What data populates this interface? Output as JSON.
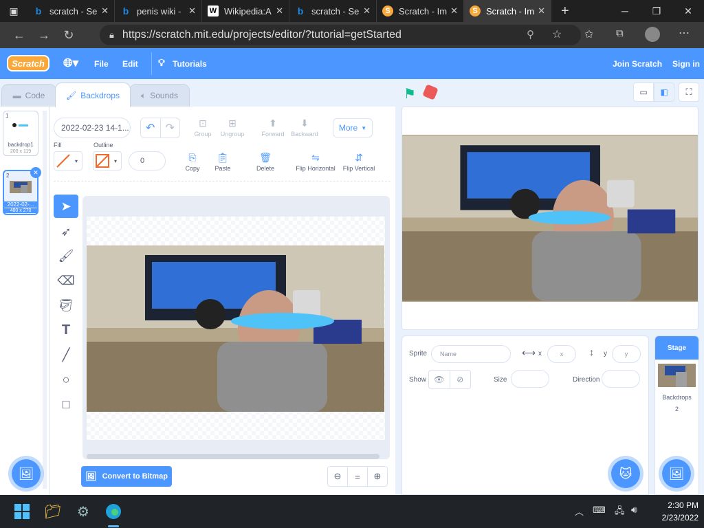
{
  "browser": {
    "tabs": [
      {
        "title": "scratch - Se",
        "icon": "bing-icon",
        "color": "#1e88e5"
      },
      {
        "title": "penis wiki -",
        "icon": "bing-icon",
        "color": "#1e88e5"
      },
      {
        "title": "Wikipedia:A",
        "icon": "wikipedia-icon",
        "color": "#ffffff"
      },
      {
        "title": "scratch - Se",
        "icon": "bing-icon",
        "color": "#1e88e5"
      },
      {
        "title": "Scratch - Im",
        "icon": "scratch-cat-icon",
        "color": "#f9a83c"
      },
      {
        "title": "Scratch - Im",
        "icon": "scratch-cat-icon",
        "color": "#f9a83c",
        "active": true
      }
    ],
    "url": "https://scratch.mit.edu/projects/editor/?tutorial=getStarted"
  },
  "menubar": {
    "logo": "Scratch",
    "file": "File",
    "edit": "Edit",
    "tutorials": "Tutorials",
    "join": "Join Scratch",
    "signin": "Sign in"
  },
  "editor_tabs": {
    "code": "Code",
    "backdrops": "Backdrops",
    "sounds": "Sounds"
  },
  "backdrops": [
    {
      "num": "1",
      "name": "backdrop1",
      "size": "200 x 119"
    },
    {
      "num": "2",
      "name": "2022-02-...",
      "size": "480 x 270",
      "selected": true
    }
  ],
  "paint": {
    "costume_name": "2022-02-23 14-1...",
    "group": "Group",
    "ungroup": "Ungroup",
    "forward": "Forward",
    "backward": "Backward",
    "more": "More",
    "fill_label": "Fill",
    "outline_label": "Outline",
    "outline_width": "0",
    "copy": "Copy",
    "paste": "Paste",
    "delete": "Delete",
    "flip_h": "Flip Horizontal",
    "flip_v": "Flip Vertical",
    "convert": "Convert to Bitmap",
    "zoom_reset": "="
  },
  "sprite_info": {
    "sprite_label": "Sprite",
    "name_placeholder": "Name",
    "x_label": "x",
    "x_placeholder": "x",
    "y_label": "y",
    "y_placeholder": "y",
    "show_label": "Show",
    "size_label": "Size",
    "direction_label": "Direction"
  },
  "stage_pane": {
    "title": "Stage",
    "backdrops_label": "Backdrops",
    "backdrops_count": "2"
  },
  "taskbar": {
    "time": "2:30 PM",
    "date": "2/23/2022"
  },
  "colors": {
    "scratch_blue": "#4c97ff",
    "accent_orange": "#f9a83c",
    "taskbar": "#202428"
  }
}
